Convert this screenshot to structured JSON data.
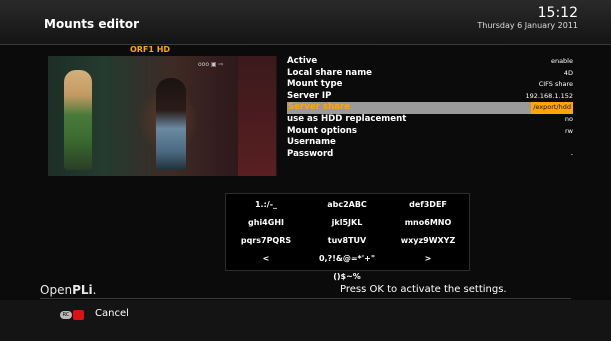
{
  "header": {
    "title": "Mounts editor",
    "time": "15:12",
    "date": "Thursday  6 January 2011"
  },
  "video": {
    "channel": "ORF1 HD",
    "osd_text": "ooo ▣ ⇨"
  },
  "settings": [
    {
      "label": "Active",
      "value": "enable",
      "selected": false
    },
    {
      "label": "Local share name",
      "value": "4D",
      "selected": false
    },
    {
      "label": "Mount type",
      "value": "CIFS share",
      "selected": false
    },
    {
      "label": "Server IP",
      "value": "192.168.1.152",
      "selected": false
    },
    {
      "label": "Server share",
      "value": "/export/hdd",
      "selected": true
    },
    {
      "label": "use as HDD replacement",
      "value": "no",
      "selected": false
    },
    {
      "label": "Mount options",
      "value": "rw",
      "selected": false
    },
    {
      "label": "Username",
      "value": "",
      "selected": false
    },
    {
      "label": "Password",
      "value": "-",
      "selected": false
    }
  ],
  "keyboard": {
    "rows": [
      [
        "1.:/-_",
        "abc2ABC",
        "def3DEF"
      ],
      [
        "ghi4GHI",
        "jkl5JKL",
        "mno6MNO"
      ],
      [
        "pqrs7PQRS",
        "tuv8TUV",
        "wxyz9WXYZ"
      ],
      [
        "<",
        "0,?!&@=*'+\"()$~%",
        ">"
      ]
    ]
  },
  "footer": {
    "brand_left": "Open",
    "brand_right": "PLi",
    "brand_suffix": ".",
    "hint": "Press OK to activate the settings.",
    "cancel_label": "Cancel",
    "remote_badge": "RC"
  },
  "colors": {
    "accent": "#ffa600",
    "selection": "#9a9a9a",
    "red_button": "#dd1111"
  }
}
